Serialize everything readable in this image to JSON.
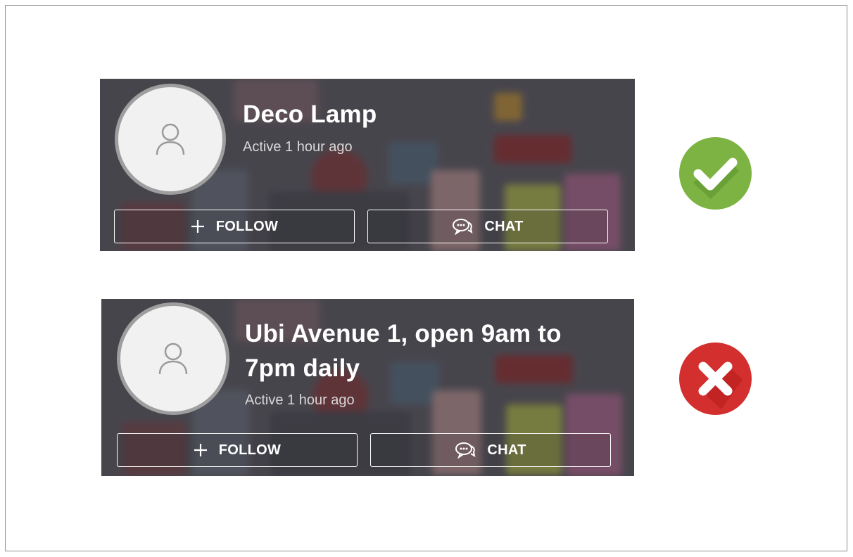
{
  "colors": {
    "approve": "#7cb342",
    "reject": "#d32f2f",
    "card_overlay": "#56535a"
  },
  "cards": [
    {
      "store_name": "Deco Lamp",
      "status": "Active 1 hour ago",
      "follow_label": "FOLLOW",
      "chat_label": "CHAT",
      "verdict": "check-icon"
    },
    {
      "store_name": "Ubi Avenue 1, open 9am to 7pm daily",
      "status": "Active 1 hour ago",
      "follow_label": "FOLLOW",
      "chat_label": "CHAT",
      "verdict": "cross-icon"
    }
  ]
}
